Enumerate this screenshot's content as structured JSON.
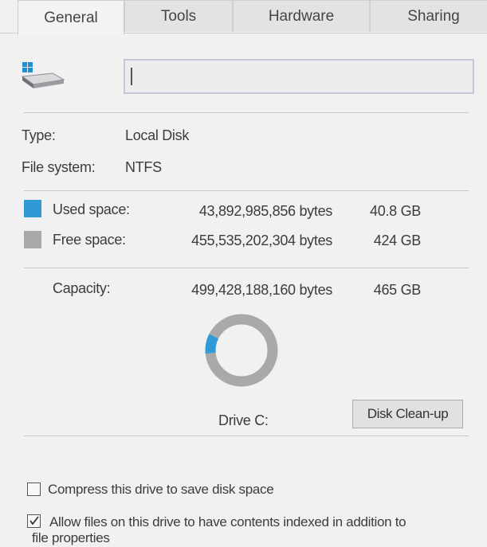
{
  "tabs": [
    {
      "label": "General",
      "active": true
    },
    {
      "label": "Tools",
      "active": false
    },
    {
      "label": "Hardware",
      "active": false
    },
    {
      "label": "Sharing",
      "active": false
    }
  ],
  "drive": {
    "icon": "drive-icon",
    "name_value": ""
  },
  "info": {
    "type_label": "Type:",
    "type_value": "Local Disk",
    "fs_label": "File system:",
    "fs_value": "NTFS"
  },
  "space": {
    "used": {
      "label": "Used space:",
      "bytes": "43,892,985,856 bytes",
      "size": "40.8 GB",
      "color": "#2f9ad6"
    },
    "free": {
      "label": "Free space:",
      "bytes": "455,535,202,304 bytes",
      "size": "424 GB",
      "color": "#a9a9a9"
    },
    "capacity": {
      "label": "Capacity:",
      "bytes": "499,428,188,160 bytes",
      "size": "465 GB"
    },
    "used_fraction": 0.088
  },
  "drive_label": "Drive C:",
  "cleanup_button": "Disk Clean-up",
  "options": {
    "compress": {
      "label": "Compress this drive to save disk space",
      "checked": false
    },
    "index": {
      "label_line1": "Allow files on this drive to have contents indexed in addition to",
      "label_line2": "file properties",
      "checked": true
    }
  }
}
